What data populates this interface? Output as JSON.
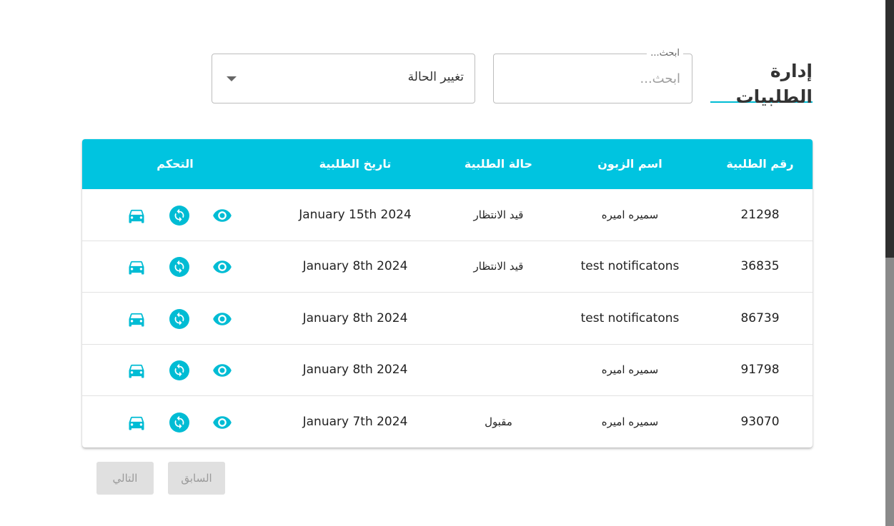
{
  "header": {
    "title": "إدارة الطلبيات"
  },
  "search": {
    "label": "ابحث...",
    "placeholder": "ابحث..."
  },
  "status_filter": {
    "selected": "تغيير الحالة"
  },
  "table": {
    "columns": [
      "رقم الطلبية",
      "اسم الزبون",
      "حالة الطلبية",
      "تاريخ الطلبية",
      "التحكم"
    ],
    "rows": [
      {
        "id": "21298",
        "customer": "سميره اميره",
        "status": "قيد الانتظار",
        "date": "January 15th 2024"
      },
      {
        "id": "36835",
        "customer": "test notificatons",
        "status": "قيد الانتظار",
        "date": "January 8th 2024"
      },
      {
        "id": "86739",
        "customer": "test notificatons",
        "status": "",
        "date": "January 8th 2024"
      },
      {
        "id": "91798",
        "customer": "سميره اميره",
        "status": "",
        "date": "January 8th 2024"
      },
      {
        "id": "93070",
        "customer": "سميره اميره",
        "status": "مقبول",
        "date": "January 7th 2024"
      }
    ]
  },
  "pagination": {
    "previous": "السابق",
    "next": "التالي"
  },
  "colors": {
    "accent": "#00c4e0",
    "icon": "#00bcd4"
  },
  "icons": {
    "view": "eye-icon",
    "status": "refresh-icon",
    "delivery": "car-icon"
  }
}
